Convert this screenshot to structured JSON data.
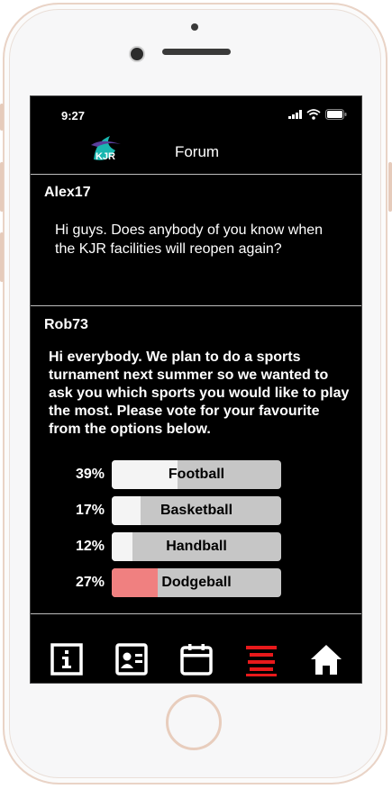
{
  "status": {
    "time": "9:27"
  },
  "header": {
    "title": "Forum",
    "logo_text": "KJR"
  },
  "posts": [
    {
      "author": "Alex17",
      "text": "Hi guys. Does anybody of you know when the KJR facilities will reopen again?"
    },
    {
      "author": "Rob73",
      "text": "Hi everybody. We plan to do a sports turnament next summer so we wanted to ask you which sports you would like to play the most. Please vote for your favourite from the options below."
    }
  ],
  "poll": {
    "options": [
      {
        "percent": "39%",
        "label": "Football",
        "value": 0.39,
        "selected": false
      },
      {
        "percent": "17%",
        "label": "Basketball",
        "value": 0.17,
        "selected": false
      },
      {
        "percent": "12%",
        "label": "Handball",
        "value": 0.12,
        "selected": false
      },
      {
        "percent": "27%",
        "label": "Dodgeball",
        "value": 0.27,
        "selected": true
      }
    ]
  },
  "nav": {
    "items": [
      {
        "icon": "info-icon",
        "active": false
      },
      {
        "icon": "contact-card-icon",
        "active": false
      },
      {
        "icon": "calendar-icon",
        "active": false
      },
      {
        "icon": "forum-icon",
        "active": true
      },
      {
        "icon": "home-icon",
        "active": false
      }
    ]
  },
  "colors": {
    "active": "#e8191b",
    "selected_fill": "#f08080",
    "bar_bg": "#c6c6c6"
  }
}
